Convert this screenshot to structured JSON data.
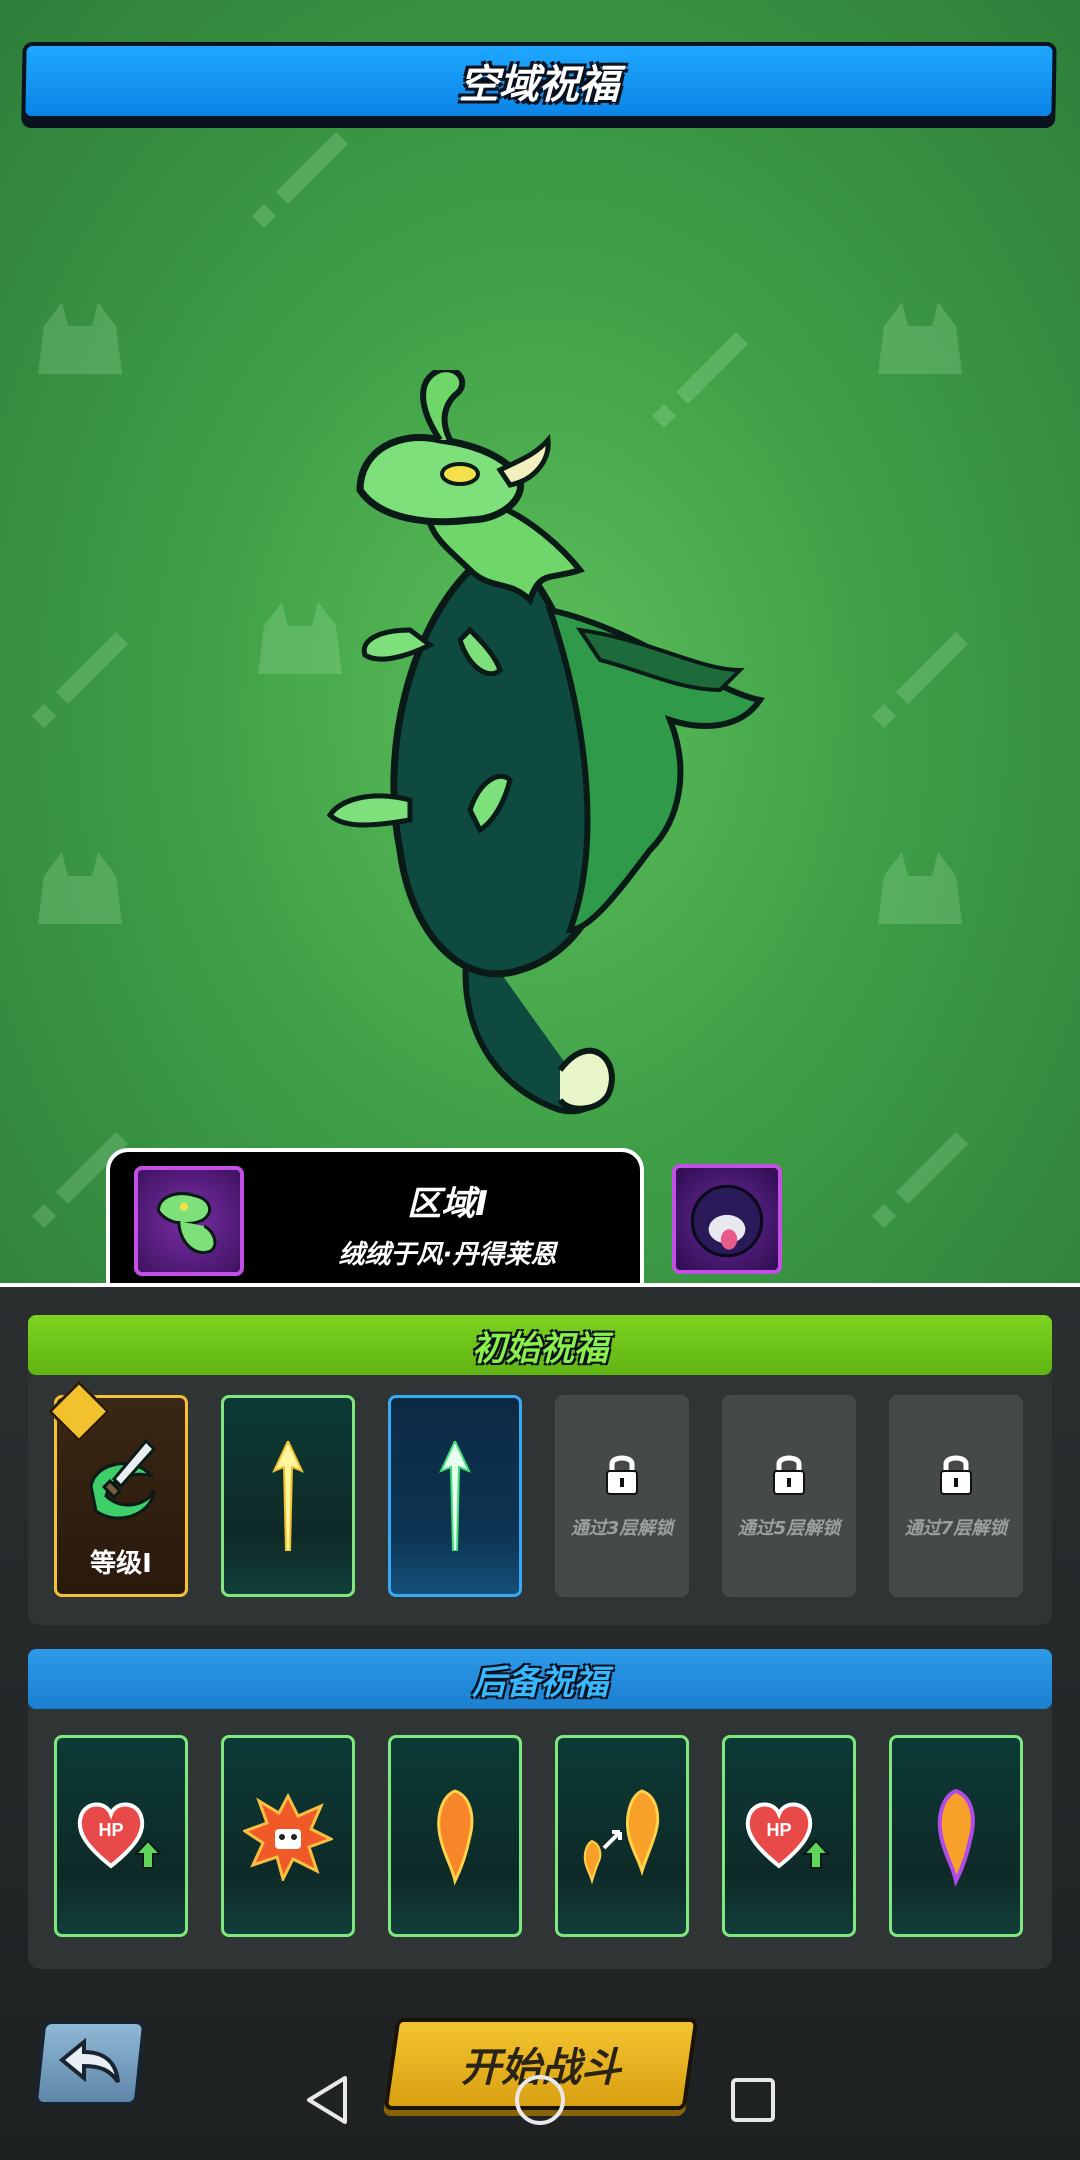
{
  "header": {
    "title": "空域祝福"
  },
  "region": {
    "name": "区域I",
    "subtitle": "绒绒于风·丹得莱恩"
  },
  "initial_blessings": {
    "title": "初始祝福",
    "cards": [
      {
        "type": "equipped",
        "icon": "sword-swirl-icon",
        "label": "等级I"
      },
      {
        "type": "green",
        "icon": "yellow-arrow-icon"
      },
      {
        "type": "blue",
        "icon": "green-arrow-icon"
      },
      {
        "type": "locked",
        "icon": "lock-icon",
        "label": "通过3层解锁"
      },
      {
        "type": "locked",
        "icon": "lock-icon",
        "label": "通过5层解锁"
      },
      {
        "type": "locked",
        "icon": "lock-icon",
        "label": "通过7层解锁"
      }
    ]
  },
  "backup_blessings": {
    "title": "后备祝福",
    "cards": [
      {
        "icon": "hp-heart-up-icon"
      },
      {
        "icon": "explosion-skull-icon"
      },
      {
        "icon": "fire-drop-icon"
      },
      {
        "icon": "fire-drop-grow-icon"
      },
      {
        "icon": "hp-heart-up-icon"
      },
      {
        "icon": "purple-fire-drop-icon"
      }
    ]
  },
  "controls": {
    "start_label": "开始战斗"
  },
  "colors": {
    "scene_green": "#4caf50",
    "title_blue": "#0b84e6",
    "initial_green": "#7ed321",
    "backup_blue": "#2d9ae8",
    "start_gold": "#f4c430"
  }
}
